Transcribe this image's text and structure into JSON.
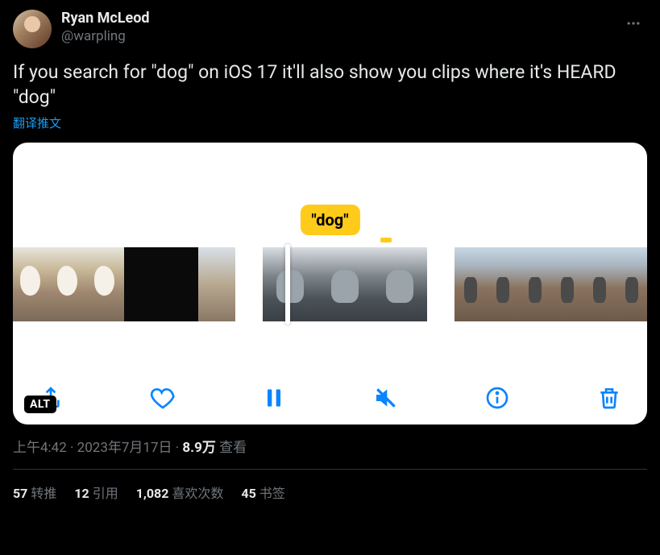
{
  "author": {
    "display_name": "Ryan McLeod",
    "handle": "@warpling"
  },
  "tweet_text": "If you search for \"dog\" on iOS 17 it'll also show you clips where it's HEARD \"dog\"",
  "translate_link": "翻译推文",
  "media": {
    "tooltip": "\"dog\"",
    "alt_badge": "ALT"
  },
  "meta": {
    "time": "上午4:42",
    "date": "2023年7月17日",
    "separator": " · ",
    "views_number": "8.9万",
    "views_label": " 查看"
  },
  "stats": {
    "retweets_count": "57",
    "retweets_label": "转推",
    "quotes_count": "12",
    "quotes_label": "引用",
    "likes_count": "1,082",
    "likes_label": "喜欢次数",
    "bookmarks_count": "45",
    "bookmarks_label": "书签"
  }
}
